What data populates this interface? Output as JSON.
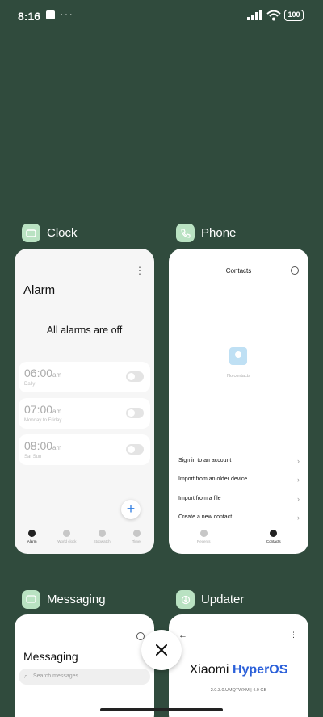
{
  "status_bar": {
    "time": "8:16",
    "dots": "···",
    "battery": "100"
  },
  "apps": {
    "clock": {
      "name": "Clock",
      "title": "Alarm",
      "empty_message": "All alarms are off",
      "alarms": [
        {
          "time": "06:00",
          "suffix": "am",
          "days": "Daily"
        },
        {
          "time": "07:00",
          "suffix": "am",
          "days": "Monday to Friday"
        },
        {
          "time": "08:00",
          "suffix": "am",
          "days": "Sat Sun"
        }
      ],
      "fab_label": "+",
      "nav": [
        "Alarm",
        "World clock",
        "Stopwatch",
        "Timer"
      ]
    },
    "phone": {
      "name": "Phone",
      "title": "Contacts",
      "empty_message": "No contacts",
      "options": [
        "Sign in to an account",
        "Import from an older device",
        "Import from a file",
        "Create a new contact"
      ],
      "nav": [
        "Recents",
        "Contacts"
      ]
    },
    "messaging": {
      "name": "Messaging",
      "title": "Messaging",
      "search_placeholder": "Search messages"
    },
    "updater": {
      "name": "Updater",
      "brand_prefix": "Xiaomi",
      "brand_name": "HyperOS",
      "version": "2.0.3.0.UMQTWXM | 4.0 GB"
    }
  },
  "colors": {
    "background": "#304b3d",
    "icon_tint": "#b9e2c2",
    "accent": "#2f7de1",
    "brand_blue": "#2a5fd9"
  }
}
